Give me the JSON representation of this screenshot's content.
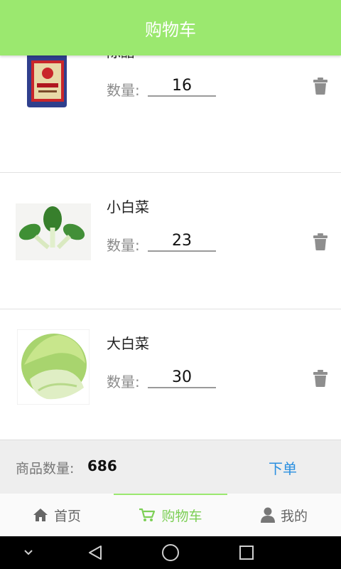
{
  "app": {
    "title": "购物车"
  },
  "cart": {
    "qty_label": "数量:",
    "items": [
      {
        "name": "陈醋",
        "quantity": "16",
        "image": "vinegar-bottle"
      },
      {
        "name": "小白菜",
        "quantity": "23",
        "image": "bok-choy"
      },
      {
        "name": "大白菜",
        "quantity": "30",
        "image": "napa-cabbage"
      }
    ]
  },
  "summary": {
    "label": "商品数量:",
    "count": "686",
    "order_label": "下单"
  },
  "tabs": [
    {
      "label": "首页",
      "icon": "home-icon"
    },
    {
      "label": "购物车",
      "icon": "cart-icon",
      "active": true
    },
    {
      "label": "我的",
      "icon": "person-icon"
    }
  ],
  "colors": {
    "accent": "#9be86f",
    "active_tab": "#7ccf55",
    "order_link": "#2a8fe0"
  }
}
